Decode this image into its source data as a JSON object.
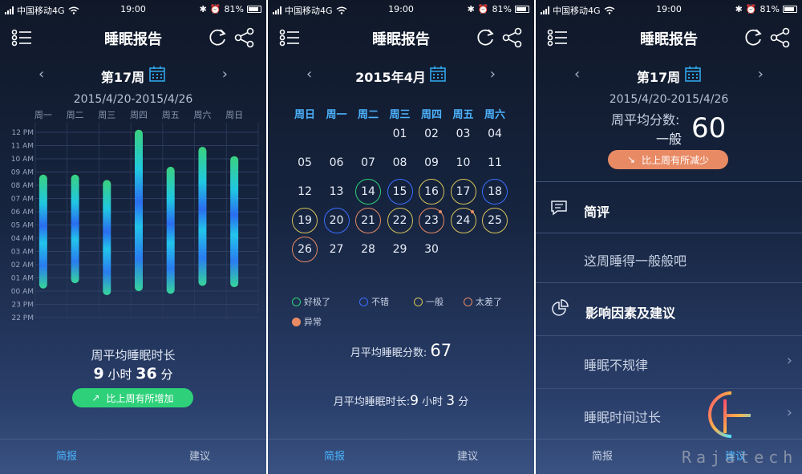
{
  "status": {
    "carrier": "中国移动4G",
    "time": "19:00",
    "battery": "81%"
  },
  "colors": {
    "accent": "#49b6ff",
    "green_pill": "#2ed17a",
    "orange_pill": "#e88a64",
    "excellent": "#2ed17a",
    "good": "#3a6fff",
    "average": "#d6c35a",
    "poor": "#e88a64",
    "abnormal": "#e88a64"
  },
  "header": {
    "title": "睡眠报告"
  },
  "tabs": {
    "summary": "简报",
    "advice": "建议"
  },
  "weekly": {
    "week_label": "第17周",
    "range": "2015/4/20-2015/4/26",
    "avg_duration_label": "周平均睡眠时长",
    "avg_hours": "9",
    "hours_unit": "小时",
    "avg_minutes": "36",
    "minutes_unit": "分",
    "compare_text": "比上周有所增加"
  },
  "chart_data": {
    "type": "bar",
    "categories": [
      "周一",
      "周二",
      "周三",
      "周四",
      "周五",
      "周六",
      "周日"
    ],
    "y_ticks": [
      "12 PM",
      "11 AM",
      "10 AM",
      "09 AM",
      "08 AM",
      "07 AM",
      "06 AM",
      "05 AM",
      "04 AM",
      "03 AM",
      "02 AM",
      "01 AM",
      "00 AM",
      "23 PM",
      "22 PM"
    ],
    "series": [
      {
        "start": [
          0.2,
          0.6,
          -0.3,
          0.0,
          -0.2,
          0.4,
          0.3
        ],
        "end": [
          8.8,
          8.8,
          8.4,
          12.2,
          9.4,
          10.9,
          10.2
        ]
      }
    ],
    "grid": true
  },
  "monthly": {
    "month_label": "2015年4月",
    "weekdays": [
      "周日",
      "周一",
      "周二",
      "周三",
      "周四",
      "周五",
      "周六"
    ],
    "days": [
      {
        "d": "01",
        "col": 3,
        "row": 0,
        "q": ""
      },
      {
        "d": "02",
        "col": 4,
        "row": 0,
        "q": ""
      },
      {
        "d": "03",
        "col": 5,
        "row": 0,
        "q": ""
      },
      {
        "d": "04",
        "col": 6,
        "row": 0,
        "q": ""
      },
      {
        "d": "05",
        "col": 0,
        "row": 1,
        "q": ""
      },
      {
        "d": "06",
        "col": 1,
        "row": 1,
        "q": ""
      },
      {
        "d": "07",
        "col": 2,
        "row": 1,
        "q": ""
      },
      {
        "d": "08",
        "col": 3,
        "row": 1,
        "q": ""
      },
      {
        "d": "09",
        "col": 4,
        "row": 1,
        "q": ""
      },
      {
        "d": "10",
        "col": 5,
        "row": 1,
        "q": ""
      },
      {
        "d": "11",
        "col": 6,
        "row": 1,
        "q": ""
      },
      {
        "d": "12",
        "col": 0,
        "row": 2,
        "q": ""
      },
      {
        "d": "13",
        "col": 1,
        "row": 2,
        "q": ""
      },
      {
        "d": "14",
        "col": 2,
        "row": 2,
        "q": "excellent"
      },
      {
        "d": "15",
        "col": 3,
        "row": 2,
        "q": "good"
      },
      {
        "d": "16",
        "col": 4,
        "row": 2,
        "q": "average"
      },
      {
        "d": "17",
        "col": 5,
        "row": 2,
        "q": "average"
      },
      {
        "d": "18",
        "col": 6,
        "row": 2,
        "q": "good"
      },
      {
        "d": "19",
        "col": 0,
        "row": 3,
        "q": "average"
      },
      {
        "d": "20",
        "col": 1,
        "row": 3,
        "q": "good"
      },
      {
        "d": "21",
        "col": 2,
        "row": 3,
        "q": "poor"
      },
      {
        "d": "22",
        "col": 3,
        "row": 3,
        "q": "average"
      },
      {
        "d": "23",
        "col": 4,
        "row": 3,
        "q": "poor",
        "dot": true
      },
      {
        "d": "24",
        "col": 5,
        "row": 3,
        "q": "average",
        "dot": true
      },
      {
        "d": "25",
        "col": 6,
        "row": 3,
        "q": "average"
      },
      {
        "d": "26",
        "col": 0,
        "row": 4,
        "q": "poor"
      },
      {
        "d": "27",
        "col": 1,
        "row": 4,
        "q": ""
      },
      {
        "d": "28",
        "col": 2,
        "row": 4,
        "q": ""
      },
      {
        "d": "29",
        "col": 3,
        "row": 4,
        "q": ""
      },
      {
        "d": "30",
        "col": 4,
        "row": 4,
        "q": ""
      }
    ],
    "legend": {
      "excellent": "好极了",
      "good": "不错",
      "average": "一般",
      "poor": "太差了",
      "abnormal": "异常"
    },
    "avg_score_label": "月平均睡眠分数:",
    "avg_score": "67",
    "avg_duration_label": "月平均睡眠时长:",
    "avg_hours": "9",
    "hours_unit": "小时",
    "avg_minutes": "3",
    "minutes_unit": "分"
  },
  "advice": {
    "week_label": "第17周",
    "range": "2015/4/20-2015/4/26",
    "avg_score_label": "周平均分数:",
    "level": "一般",
    "score": "60",
    "compare_text": "比上周有所减少",
    "comment_title": "简评",
    "comment_text": "这周睡得一般般吧",
    "factors_title": "影响因素及建议",
    "factors": [
      "睡眠不规律",
      "睡眠时间过长"
    ]
  },
  "watermark": {
    "text": "Rajatech"
  }
}
